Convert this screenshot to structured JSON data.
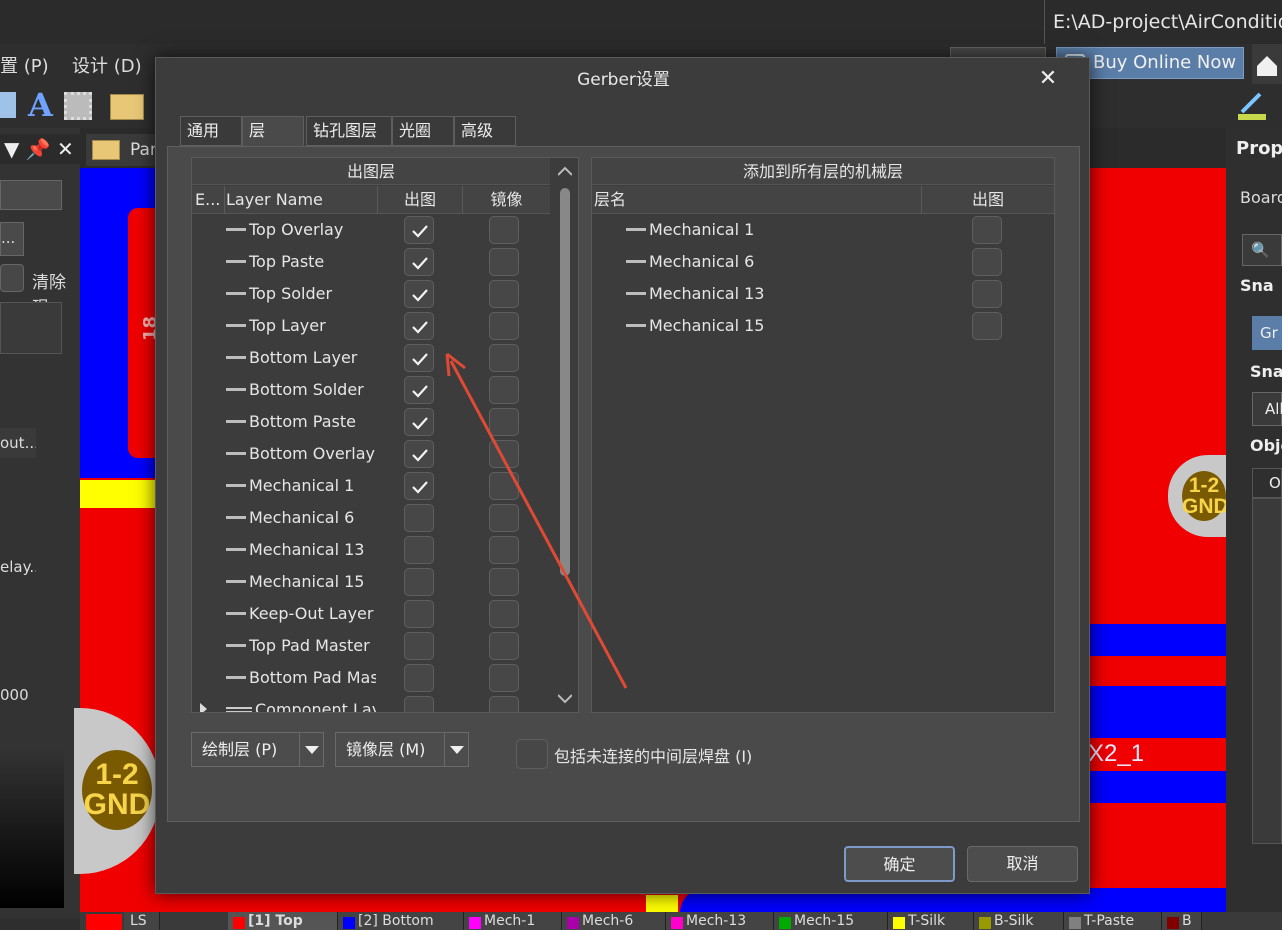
{
  "app": {
    "title_path": "E:\\AD-project\\AirConditioner",
    "menu": [
      "置 (P)",
      "设计 (D)"
    ],
    "buy_online": "Buy Online Now",
    "doc_tab": "Par",
    "properties_title": "Prope",
    "properties_board": "Board",
    "properties_snap": "Sna",
    "properties_snap2": "Snap",
    "properties_gr": "Gr",
    "properties_all": "All",
    "properties_obj": "Obje",
    "properties_on": "On",
    "left_panel": {
      "clear": "清除现",
      "item1": "out...",
      "item2": "elay...",
      "item3": "000"
    },
    "canvas_labels": {
      "pad_left": {
        "line1": "1-2",
        "line2": "GND"
      },
      "pad_right": {
        "line1": "1-2",
        "line2": "GND"
      },
      "designator": "X2_1",
      "rotated": "18"
    },
    "bottom_tabs": [
      {
        "label": "LS",
        "color": ""
      },
      {
        "label": "[1] Top",
        "color": "#ff0000"
      },
      {
        "label": "[2] Bottom",
        "color": "#0000ff"
      },
      {
        "label": "Mech-1",
        "color": "#ff00ff"
      },
      {
        "label": "Mech-6",
        "color": "#aa00aa"
      },
      {
        "label": "Mech-13",
        "color": "#ff00cc"
      },
      {
        "label": "Mech-15",
        "color": "#00aa00"
      },
      {
        "label": "T-Silk",
        "color": "#ffff00"
      },
      {
        "label": "B-Silk",
        "color": "#999900"
      },
      {
        "label": "T-Paste",
        "color": "#808080"
      },
      {
        "label": "B",
        "color": "#800000"
      }
    ]
  },
  "dialog": {
    "title": "Gerber设置",
    "close": "✕",
    "tabs": [
      "通用",
      "层",
      "钻孔图层",
      "光圈",
      "高级"
    ],
    "active_tab": 1,
    "left_table": {
      "group_header": "出图层",
      "col_e": "E...",
      "col_name": "Layer Name",
      "col_plot": "出图",
      "col_mirror": "镜像",
      "rows": [
        {
          "name": "Top Overlay",
          "plot": true,
          "mirror": false
        },
        {
          "name": "Top Paste",
          "plot": true,
          "mirror": false
        },
        {
          "name": "Top Solder",
          "plot": true,
          "mirror": false
        },
        {
          "name": "Top Layer",
          "plot": true,
          "mirror": false
        },
        {
          "name": "Bottom Layer",
          "plot": true,
          "mirror": false
        },
        {
          "name": "Bottom Solder",
          "plot": true,
          "mirror": false
        },
        {
          "name": "Bottom Paste",
          "plot": true,
          "mirror": false
        },
        {
          "name": "Bottom Overlay",
          "plot": true,
          "mirror": false
        },
        {
          "name": "Mechanical 1",
          "plot": true,
          "mirror": false
        },
        {
          "name": "Mechanical 6",
          "plot": false,
          "mirror": false
        },
        {
          "name": "Mechanical 13",
          "plot": false,
          "mirror": false
        },
        {
          "name": "Mechanical 15",
          "plot": false,
          "mirror": false
        },
        {
          "name": "Keep-Out Layer",
          "plot": false,
          "mirror": false
        },
        {
          "name": "Top Pad Master",
          "plot": false,
          "mirror": false
        },
        {
          "name": "Bottom Pad Master",
          "plot": false,
          "mirror": false
        },
        {
          "name": "Component Layer Pairs",
          "plot": false,
          "mirror": false
        }
      ]
    },
    "right_table": {
      "group_header": "添加到所有层的机械层",
      "col_name": "层名",
      "col_plot": "出图",
      "rows": [
        {
          "name": "Mechanical 1",
          "plot": false
        },
        {
          "name": "Mechanical 6",
          "plot": false
        },
        {
          "name": "Mechanical 13",
          "plot": false
        },
        {
          "name": "Mechanical 15",
          "plot": false
        }
      ]
    },
    "plot_layers_button": "绘制层 (P)",
    "mirror_layers_button": "镜像层 (M)",
    "include_unconnected": {
      "label": "包括未连接的中间层焊盘 (I)",
      "checked": false
    },
    "ok": "确定",
    "cancel": "取消",
    "arrow_color": "#e04a35"
  }
}
